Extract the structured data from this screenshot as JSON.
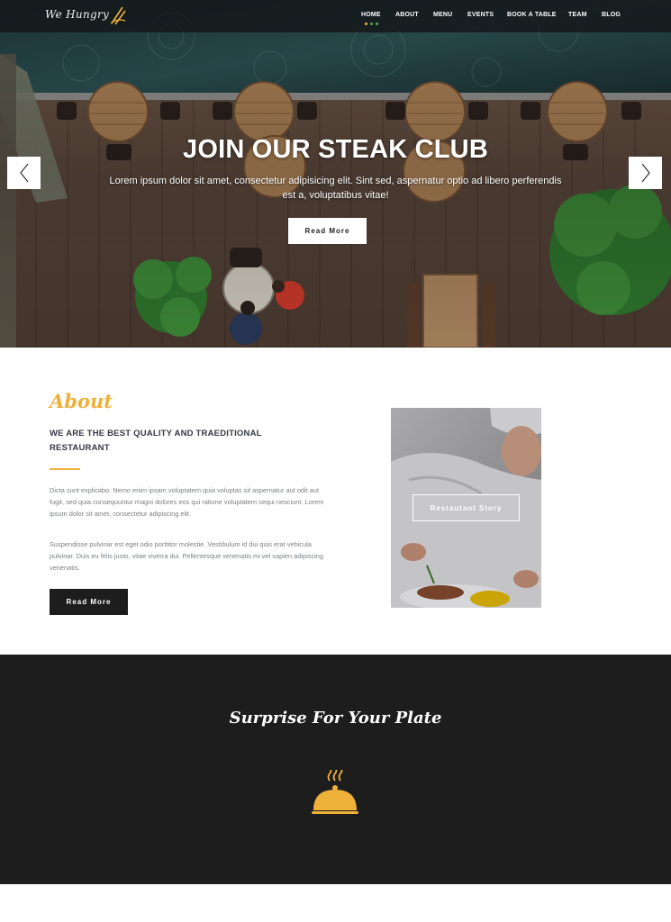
{
  "brand": {
    "name": "We Hungry"
  },
  "nav": {
    "items": [
      "HOME",
      "ABOUT",
      "MENU",
      "EVENTS",
      "BOOK A TABLE",
      "TEAM",
      "BLOG"
    ],
    "active": "HOME",
    "indicator_colors": [
      "#eeb13a",
      "#4caf50",
      "#4caf50"
    ]
  },
  "hero": {
    "title": "JOIN OUR STEAK CLUB",
    "subtitle": "Lorem ipsum dolor sit amet, consectetur adipisicing elit. Sint sed, aspernatur optio ad libero perferendis est a, voluptatibus vitae!",
    "button_label": "Read More",
    "prev_icon": "chevron-left-icon",
    "next_icon": "chevron-right-icon"
  },
  "about": {
    "heading": "About",
    "subheading": "WE ARE THE BEST QUALITY AND TRAEDITIONAL RESTAURANT",
    "paragraph1": "Dicta sunt explicabo. Nemo enim ipsam voluptatem quia voluptas sit aspernatur aut odit aut fugit, sed quia consequuntur magni dolores eos qui ratione voluptatem sequi nesciunt. Lorem ipsum dolor sit amet, consectetur adipiscing elit.",
    "paragraph2": "Suspendisse pulvinar est eget odio porttitor molestie. Vestibulum id dui quis erat vehicula pulvinar. Duis eu felis justo, vitae viverra dui. Pellentesque venenatis mi vel sapien adipiscing venenatis.",
    "button_label": "Read More",
    "story_button_label": "Restautant Story"
  },
  "surprise": {
    "title": "Surprise For Your Plate",
    "icon": "cloche-icon"
  },
  "colors": {
    "accent": "#eeb13a",
    "dark": "#1d1d1d",
    "heading_text": "#333a45"
  }
}
